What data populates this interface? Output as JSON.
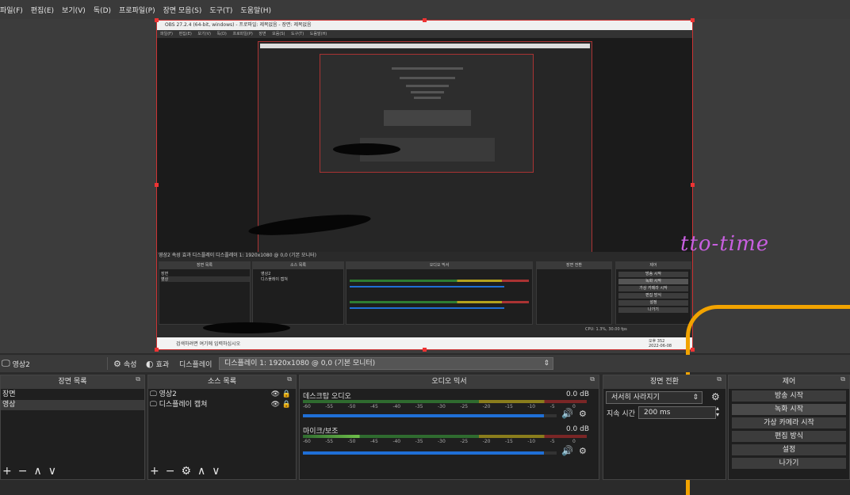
{
  "menu": [
    "파일(F)",
    "편집(E)",
    "보기(V)",
    "독(D)",
    "프로파일(P)",
    "장면 모음(S)",
    "도구(T)",
    "도움말(H)"
  ],
  "nested": {
    "title": "OBS 27.2.4 (64-bit, windows) - 프로파일: 제목없음 - 장면: 제목없음",
    "menu": "파일(F) 편집(E) 보기(V) 독(D) 프로파일(P) 장면 모음(S) 도구(T) 도움말(H)",
    "scene_bar": "영상2   속성 효과   디스플레이   디스플레이 1: 1920x1080 @ 0,0 (기본 모니터)",
    "panels": [
      "장면 목록",
      "소스 목록",
      "오디오 믹서",
      "장면 전환",
      "제어"
    ],
    "scenes": [
      "장면",
      "영상"
    ],
    "sources": [
      "영상2",
      "디스플레이 캡쳐"
    ],
    "controls": [
      "방송 시작",
      "녹화 시작",
      "가상 카메라 시작",
      "편집 방식",
      "설정",
      "나가기"
    ],
    "taskbar_search": "검색하려면 여기에 입력하십시오",
    "clock": "오후 352",
    "date": "2022-06-08",
    "status": "CPU: 1.3%, 30.00 fps"
  },
  "watermark": "tto-time",
  "scene_bar": {
    "scene_name": "영상2",
    "properties": "속성",
    "filters": "효과",
    "display": "디스플레이",
    "display_value": "디스플레이 1: 1920x1080 @ 0,0 (기본 모니터)"
  },
  "scenes": {
    "title": "장면 목록",
    "items": [
      "장면",
      "영상"
    ]
  },
  "sources": {
    "title": "소스 목록",
    "items": [
      "영상2",
      "디스플레이 캡쳐"
    ]
  },
  "mixer": {
    "title": "오디오 믹서",
    "channels": [
      {
        "name": "데스크탑 오디오",
        "db": "0.0 dB",
        "volume": 0.95
      },
      {
        "name": "마이크/보조",
        "db": "0.0 dB",
        "volume": 0.95
      }
    ],
    "ticks": [
      "-60",
      "-55",
      "-50",
      "-45",
      "-40",
      "-35",
      "-30",
      "-25",
      "-20",
      "-15",
      "-10",
      "-5",
      "0"
    ]
  },
  "transitions": {
    "title": "장면 전환",
    "type": "서서히 사라지기",
    "duration_label": "지속 시간",
    "duration_value": "200 ms"
  },
  "controls": {
    "title": "제어",
    "buttons": [
      "방송 시작",
      "녹화 시작",
      "가상 카메라 시작",
      "편집 방식",
      "설정",
      "나가기"
    ],
    "active": "녹화 시작"
  },
  "colors": {
    "accent": "#1f6fd6",
    "selection_border": "#e33333",
    "annotation": "#f2a300",
    "watermark": "#c85fe0"
  }
}
